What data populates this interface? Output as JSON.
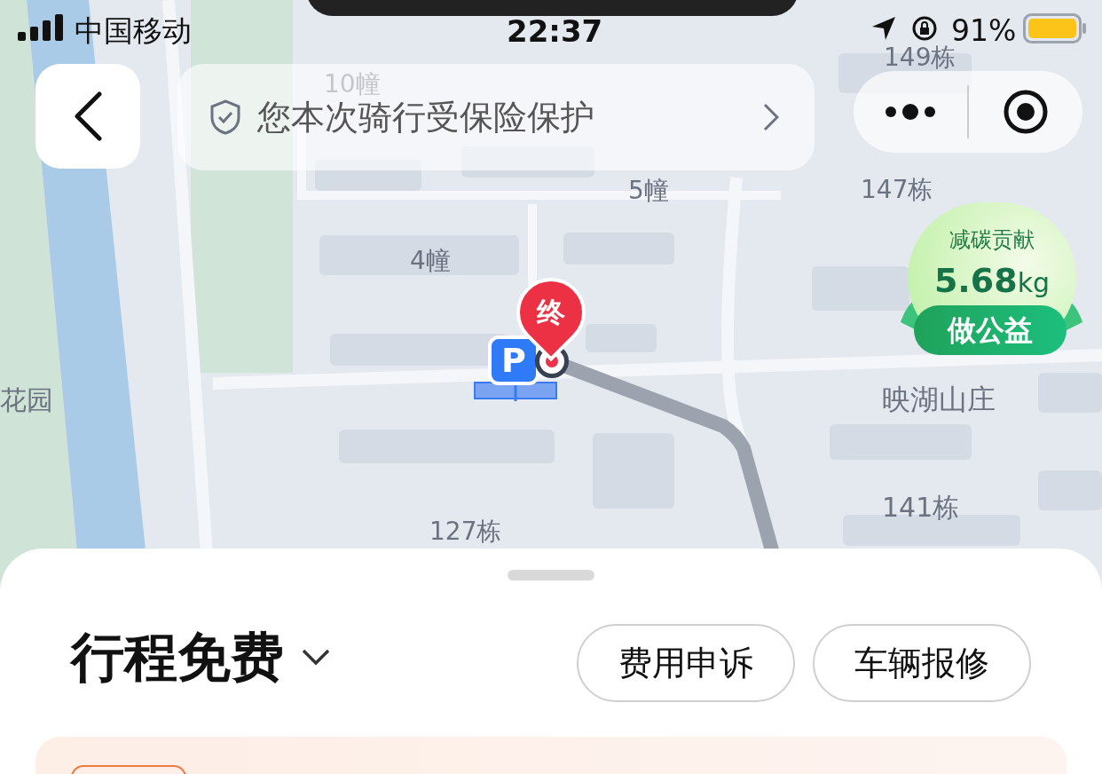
{
  "status_bar": {
    "carrier": "中国移动",
    "time": "22:37",
    "battery": "91%"
  },
  "top_bar": {
    "insurance_text": "您本次骑行受保险保护"
  },
  "map": {
    "labels": [
      "10幢",
      "149栋",
      "5幢",
      "147栋",
      "4幢",
      "花园",
      "映湖山庄",
      "141栋",
      "127栋"
    ],
    "end_marker": "终",
    "parking_marker": "P"
  },
  "carbon_badge": {
    "title": "减碳贡献",
    "amount": "5.68",
    "unit": "kg",
    "button": "做公益"
  },
  "sheet": {
    "title": "行程免费",
    "buttons": [
      "费用申诉",
      "车辆报修"
    ]
  }
}
